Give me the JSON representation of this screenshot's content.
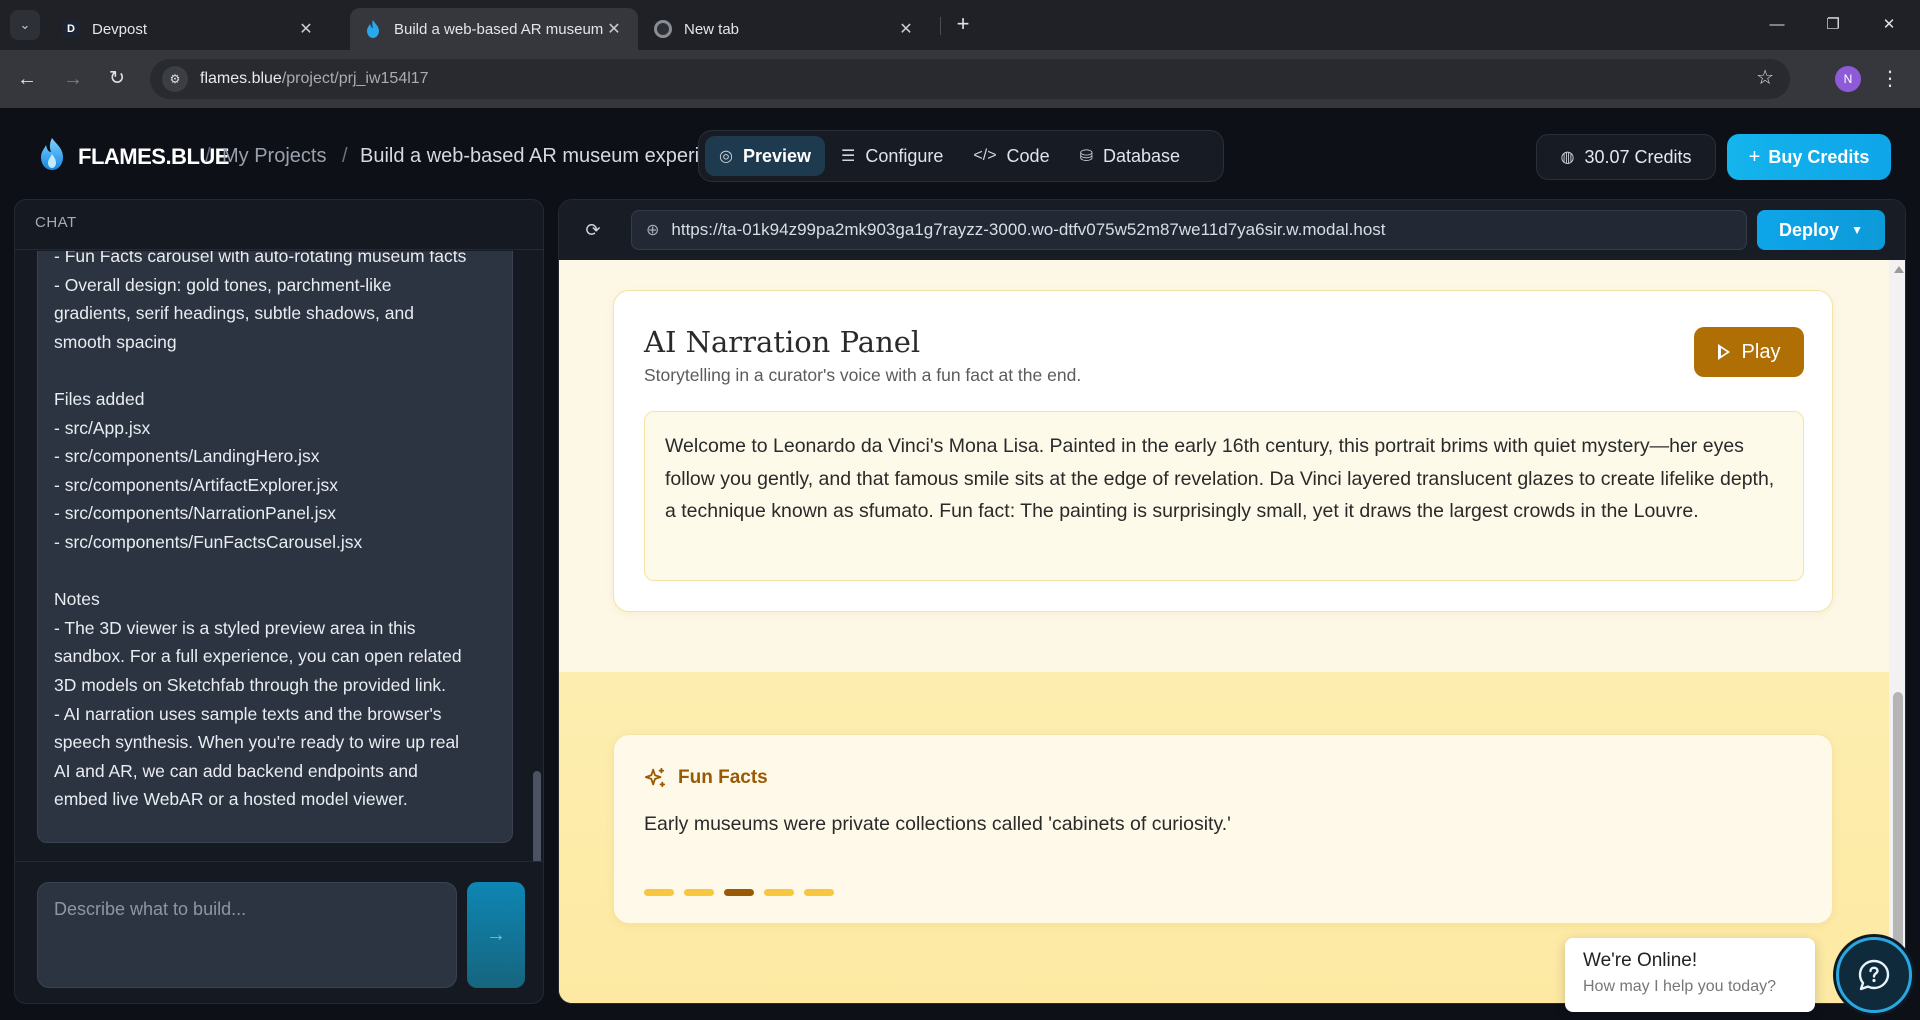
{
  "browser": {
    "tabs": [
      {
        "title": "Devpost",
        "favicon": "D"
      },
      {
        "title": "Build a web-based AR museum"
      },
      {
        "title": "New tab"
      }
    ],
    "url_host": "flames.blue",
    "url_path": "/project/prj_iw154l17",
    "profile_initial": "N"
  },
  "header": {
    "logo": "FLAMES.BLUE",
    "breadcrumb_sep": "/",
    "breadcrumb_projects": "My Projects",
    "breadcrumb_current": "Build a web-based AR museum experience",
    "modes": [
      {
        "label": "Preview",
        "icon": "compass-icon",
        "active": true
      },
      {
        "label": "Configure",
        "icon": "sliders-icon"
      },
      {
        "label": "Code",
        "icon": "code-icon"
      },
      {
        "label": "Database",
        "icon": "database-icon"
      }
    ],
    "credits": "30.07 Credits",
    "buy_label": "Buy Credits"
  },
  "chat": {
    "heading": "CHAT",
    "message_lines": [
      "- Fun Facts carousel with auto-rotating museum facts",
      "- Overall design: gold tones, parchment-like",
      "gradients, serif headings, subtle shadows, and",
      "smooth spacing",
      "",
      "Files added",
      "- src/App.jsx",
      "- src/components/LandingHero.jsx",
      "- src/components/ArtifactExplorer.jsx",
      "- src/components/NarrationPanel.jsx",
      "- src/components/FunFactsCarousel.jsx",
      "",
      "Notes",
      "- The 3D viewer is a styled preview area in this",
      "sandbox. For a full experience, you can open related",
      "3D models on Sketchfab through the provided link.",
      "- AI narration uses sample texts and the browser's",
      "speech synthesis. When you're ready to wire up real",
      "AI and AR, we can add backend endpoints and",
      "embed live WebAR or a hosted model viewer."
    ],
    "input_placeholder": "Describe what to build...",
    "send_label": "→"
  },
  "preview": {
    "url": "https://ta-01k94z99pa2mk903ga1g7rayzz-3000.wo-dtfv075w52m87we11d7ya6sir.w.modal.host",
    "deploy_label": "Deploy"
  },
  "site": {
    "narration": {
      "title": "AI Narration Panel",
      "subtitle": "Storytelling in a curator's voice with a fun fact at the end.",
      "play_label": "Play",
      "text": "Welcome to Leonardo da Vinci's Mona Lisa. Painted in the early 16th century, this portrait brims with quiet mystery—her eyes follow you gently, and that famous smile sits at the edge of revelation. Da Vinci layered translucent glazes to create lifelike depth, a technique known as sfumato. Fun fact: The painting is surprisingly small, yet it draws the largest crowds in the Louvre."
    },
    "facts": {
      "heading": "Fun Facts",
      "text": "Early museums were private collections called 'cabinets of curiosity.'",
      "total": 5,
      "active_index": 2
    }
  },
  "widget": {
    "title": "We're Online!",
    "subtitle": "How may I help you today?"
  },
  "colors": {
    "accent": "#0ea5e9",
    "gold": "#b06f05",
    "gold_dark": "#9a5a05",
    "dot": "#f8c63f"
  }
}
